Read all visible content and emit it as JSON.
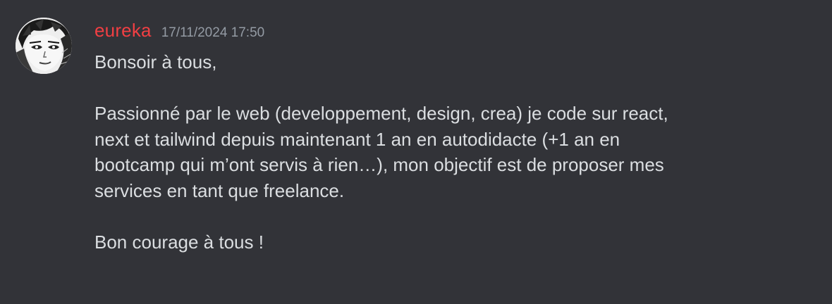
{
  "message": {
    "author": {
      "username": "eureka",
      "username_color": "#f23f43",
      "avatar_icon": "manga-character-avatar"
    },
    "timestamp": "17/11/2024 17:50",
    "lines": [
      "Bonsoir à tous,",
      "",
      "Passionné par le web (developpement, design, crea) je code sur react,",
      "next et tailwind depuis maintenant 1 an en autodidacte (+1 an en",
      "bootcamp qui m’ont servis à rien…), mon objectif est de proposer mes",
      "services en tant que freelance.",
      "",
      "Bon courage à tous !"
    ]
  },
  "colors": {
    "background": "#323338",
    "text": "#dbdee1",
    "timestamp": "#949ba4"
  }
}
